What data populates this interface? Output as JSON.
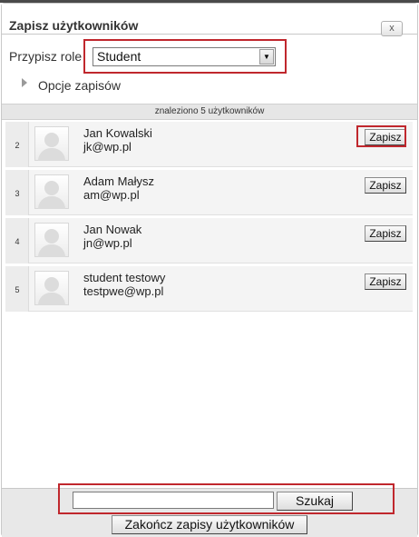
{
  "dialog": {
    "title": "Zapisz użytkowników",
    "close_label": "x"
  },
  "role": {
    "label": "Przypisz role",
    "selected": "Student"
  },
  "options": {
    "label": "Opcje zapisów"
  },
  "results": {
    "found_text": "znaleziono 5 użytkowników"
  },
  "users": [
    {
      "index": "2",
      "name": "Jan Kowalski",
      "email": "jk@wp.pl",
      "button": "Zapisz"
    },
    {
      "index": "3",
      "name": "Adam Małysz",
      "email": "am@wp.pl",
      "button": "Zapisz"
    },
    {
      "index": "4",
      "name": "Jan Nowak",
      "email": "jn@wp.pl",
      "button": "Zapisz"
    },
    {
      "index": "5",
      "name": "student testowy",
      "email": "testpwe@wp.pl",
      "button": "Zapisz"
    }
  ],
  "search": {
    "value": "",
    "button_label": "Szukaj"
  },
  "footer": {
    "finish_label": "Zakończ zapisy użytkowników"
  },
  "colors": {
    "highlight": "#c0272d",
    "found_bar": "#e6e6e6",
    "row_background": "#f4f4f4"
  }
}
